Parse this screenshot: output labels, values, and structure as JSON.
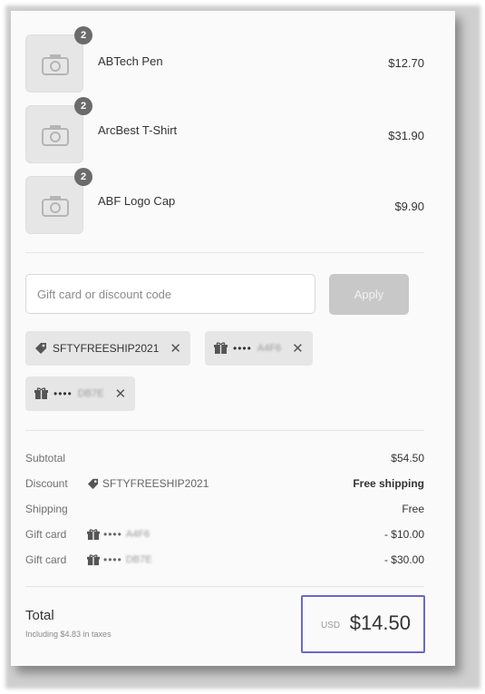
{
  "items": [
    {
      "qty": "2",
      "name": "ABTech Pen",
      "price": "$12.70"
    },
    {
      "qty": "2",
      "name": "ArcBest T-Shirt",
      "price": "$31.90"
    },
    {
      "qty": "2",
      "name": "ABF Logo Cap",
      "price": "$9.90"
    }
  ],
  "discount": {
    "placeholder": "Gift card or discount code",
    "apply_label": "Apply"
  },
  "tags": [
    {
      "icon": "tag-icon",
      "text": "SFTYFREESHIP2021"
    },
    {
      "icon": "gift-icon",
      "dots": "••••",
      "text": "A4F6"
    },
    {
      "icon": "gift-icon",
      "dots": "••••",
      "text": "DB7E"
    }
  ],
  "summary": {
    "subtotal_label": "Subtotal",
    "subtotal_value": "$54.50",
    "discount_label": "Discount",
    "discount_code": "SFTYFREESHIP2021",
    "discount_value": "Free shipping",
    "shipping_label": "Shipping",
    "shipping_value": "Free",
    "giftcard1_label": "Gift card",
    "giftcard1_dots": "••••",
    "giftcard1_code": "A4F6",
    "giftcard1_value": "- $10.00",
    "giftcard2_label": "Gift card",
    "giftcard2_dots": "••••",
    "giftcard2_code": "DB7E",
    "giftcard2_value": "- $30.00"
  },
  "total": {
    "label": "Total",
    "tax_note": "Including $4.83 in taxes",
    "currency": "USD",
    "amount": "$14.50"
  },
  "colors": {
    "total_border": "#6b68c8",
    "button_disabled": "#c8c8c8"
  }
}
